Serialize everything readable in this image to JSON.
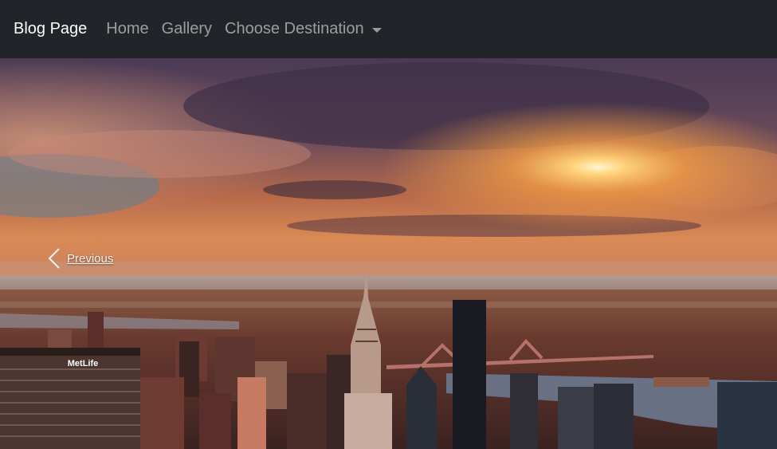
{
  "navbar": {
    "brand": "Blog Page",
    "links": [
      "Home",
      "Gallery"
    ],
    "dropdown_label": "Choose Destination"
  },
  "carousel": {
    "prev_label": "Previous",
    "building_sign": "MetLife"
  },
  "colors": {
    "navbar_bg": "#212529",
    "nav_link": "rgba(255,255,255,0.55)",
    "brand": "#ffffff"
  },
  "icons": {
    "prev": "chevron-left-icon",
    "dropdown": "caret-down-icon"
  }
}
